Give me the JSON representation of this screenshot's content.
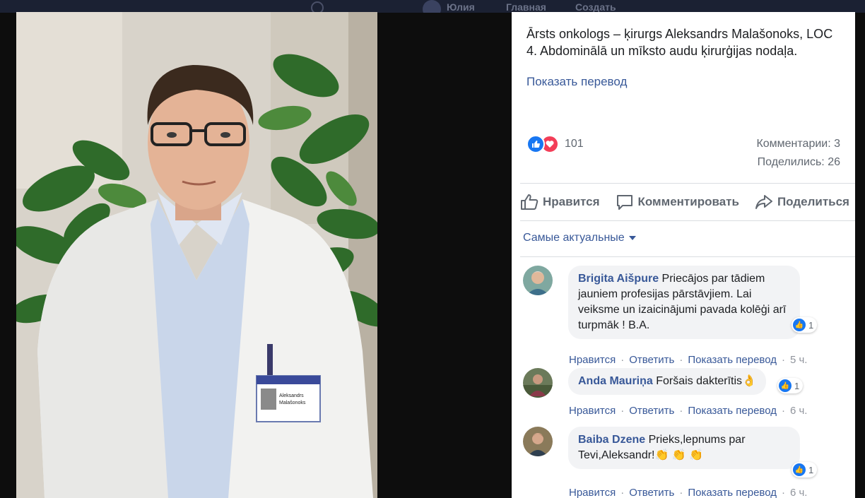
{
  "topbar": {
    "user": "Юлия",
    "home": "Главная",
    "create": "Создать"
  },
  "post": {
    "caption": "Ārsts onkologs – ķirurgs Aleksandrs Malašonoks, LOC 4. Abdominālā un mīksto audu ķirurģijas nodaļa.",
    "translate": "Показать перевод",
    "reactions_count": "101",
    "comments": "Комментарии: 3",
    "shares": "Поделились: 26"
  },
  "actions": {
    "like": "Нравится",
    "comment": "Комментировать",
    "share": "Поделиться"
  },
  "sort": {
    "label": "Самые актуальные"
  },
  "comments": [
    {
      "name": "Brigita Aišpure",
      "text": " Priecājos par tādiem jauniem profesijas pārstāvjiem. Lai veiksme un izaicinājumi pavada kolēģi arī turpmāk ! B.A.",
      "reactions": "1",
      "like": "Нравится",
      "reply": "Ответить",
      "translate": "Показать перевод",
      "time": "5 ч."
    },
    {
      "name": "Anda Mauriņa",
      "text": " Foršais dakterītis",
      "emoji": "👌",
      "reactions": "1",
      "like": "Нравится",
      "reply": "Ответить",
      "translate": "Показать перевод",
      "time": "6 ч."
    },
    {
      "name": "Baiba Dzene",
      "text": " Prieks,lepnums par Tevi,Aleksandr!",
      "emoji": "👏 👏 👏",
      "reactions": "1",
      "like": "Нравится",
      "reply": "Ответить",
      "translate": "Показать перевод",
      "time": "6 ч."
    }
  ],
  "photo_badge": {
    "line1": "Aleksandrs",
    "line2": "Malašonoks"
  },
  "colors": {
    "link": "#385898",
    "like_blue": "#1877f2",
    "love_red": "#f33e58",
    "bubble": "#f2f3f5",
    "muted": "#606770"
  }
}
